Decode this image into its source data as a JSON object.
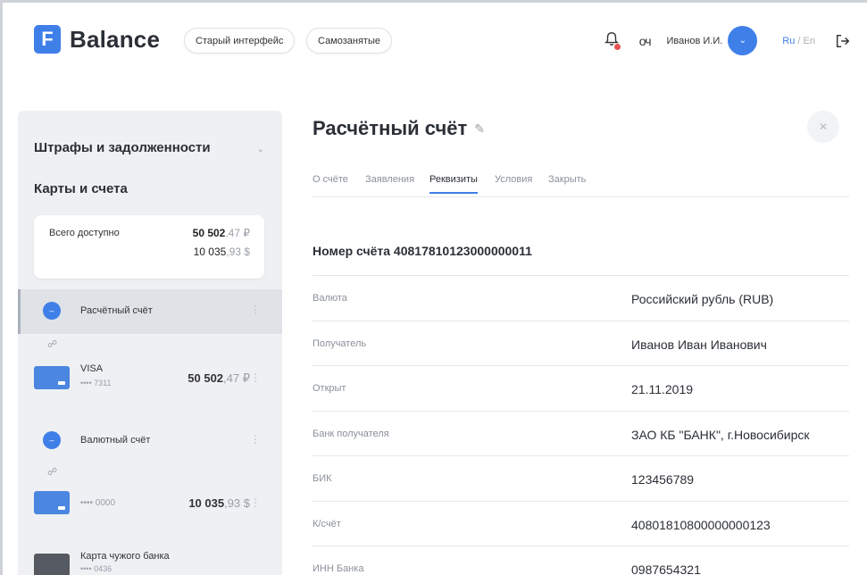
{
  "header": {
    "logo_letter": "F",
    "logo_text": "Balance",
    "old_ui_label": "Старый интерфейс",
    "self_employed_label": "Самозанятые",
    "keys_glyph": "оч",
    "user_name": "Иванов И.И.",
    "lang_ru": "Ru",
    "lang_sep": "/",
    "lang_en": "En"
  },
  "sidebar": {
    "fines_title": "Штрафы и задолженности",
    "cards_title": "Карты и счета",
    "total": {
      "label": "Всего доступно",
      "rub_int": "50 502",
      "rub_frac": ",47 ₽",
      "usd_int": "10 035",
      "usd_frac": ",93 $"
    },
    "accounts": [
      {
        "name": "Расчётный счёт",
        "card": {
          "title": "VISA",
          "number": "•••• 7311",
          "amt_int": "50 502",
          "amt_frac": ",47 ₽"
        }
      },
      {
        "name": "Валютный счёт",
        "card": {
          "title": "",
          "number": "•••• 0000",
          "amt_int": "10 035",
          "amt_frac": ",93 $"
        }
      }
    ],
    "foreign_card": {
      "title": "Карта чужого банка",
      "number": "•••• 0436"
    }
  },
  "main": {
    "title": "Расчётный счёт",
    "tabs": [
      "О счёте",
      "Заявления",
      "Реквизиты",
      "Условия",
      "Закрыть"
    ],
    "account_number": "Номер счёта 40817810123000000011",
    "details": [
      {
        "label": "Валюта",
        "value": "Российский рубль (RUB)"
      },
      {
        "label": "Получатель",
        "value": "Иванов Иван Иванович"
      },
      {
        "label": "Открыт",
        "value": "21.11.2019"
      },
      {
        "label": "Банк получателя",
        "value": "ЗАО КБ \"БАНК\", г.Новосибирск"
      },
      {
        "label": "БИК",
        "value": "123456789"
      },
      {
        "label": "К/счёт",
        "value": "40801810800000000123"
      },
      {
        "label": "ИНН Банка",
        "value": "0987654321"
      }
    ]
  },
  "colors": {
    "accent": "#3f7fe8",
    "notification": "#e85050"
  }
}
